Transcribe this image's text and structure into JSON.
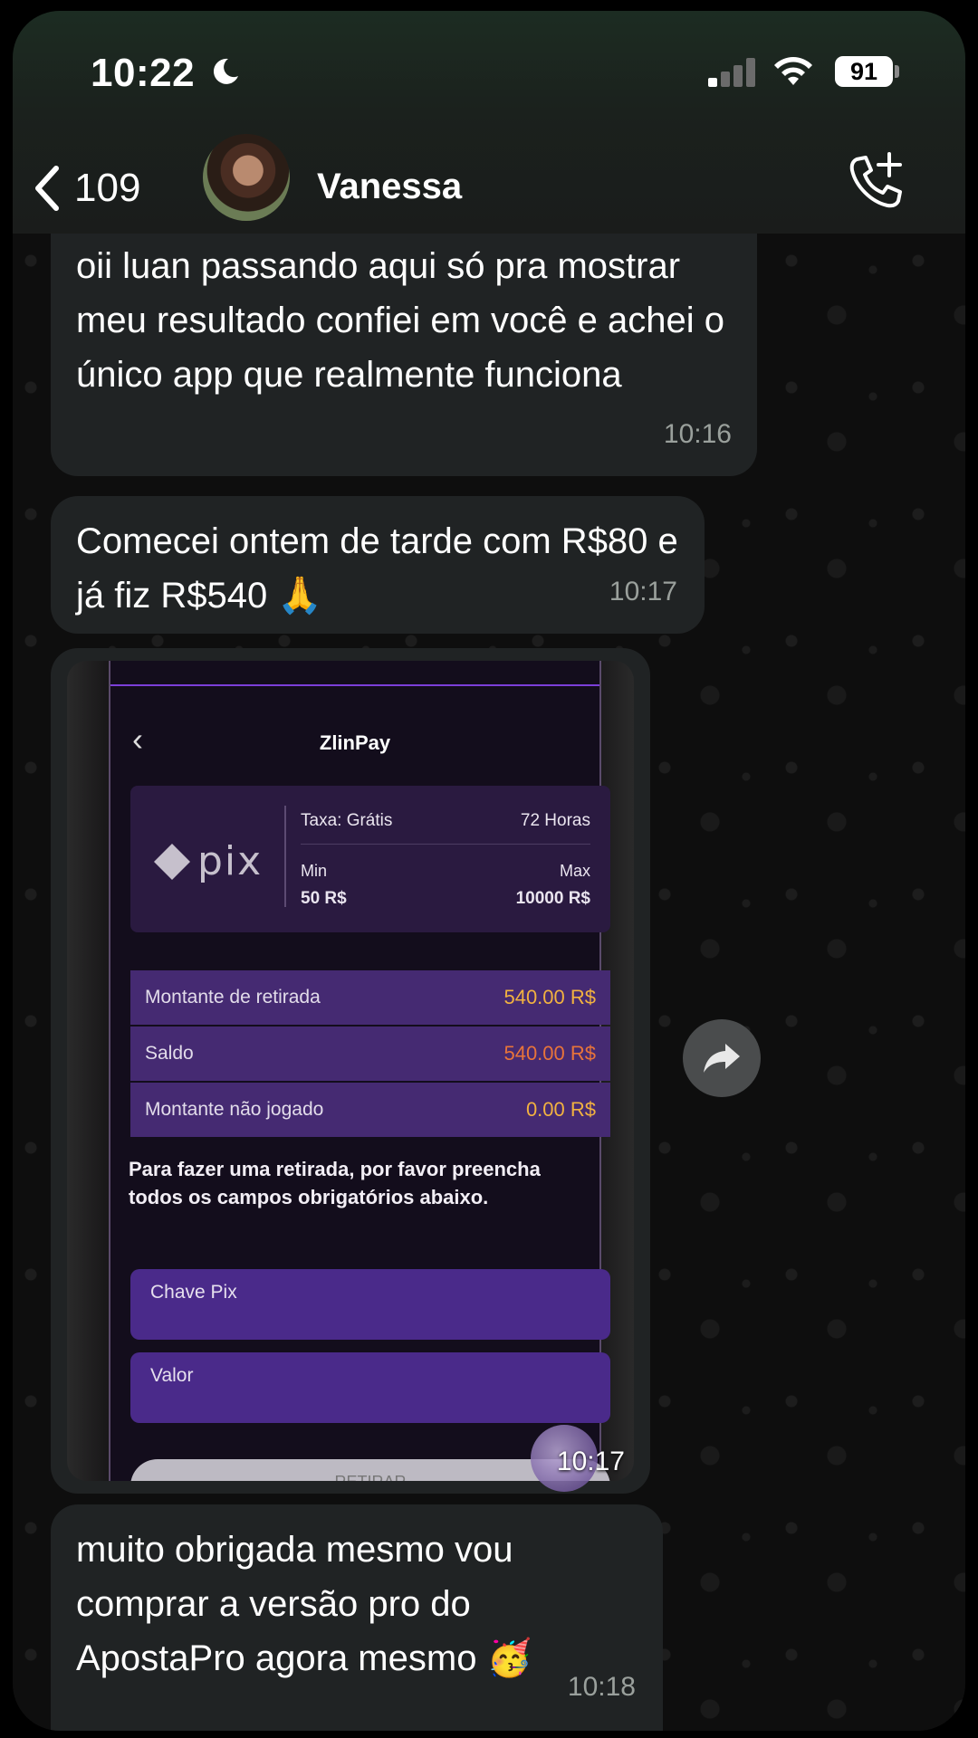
{
  "status_bar": {
    "time": "10:22",
    "battery": "91"
  },
  "header": {
    "back_count": "109",
    "contact_name": "Vanessa"
  },
  "messages": [
    {
      "text": "oii luan passando aqui só pra mostrar meu resultado confiei em você e achei o único app que realmente funciona",
      "time": "10:16"
    },
    {
      "text": "Comecei ontem de tarde com R$80 e já fiz R$540 🙏",
      "time": "10:17"
    },
    {
      "type": "image",
      "time": "10:17"
    },
    {
      "text": "muito obrigada mesmo vou comprar a versão pro do ApostaPro agora mesmo 🥳",
      "time": "10:18"
    }
  ],
  "screenshot": {
    "title": "ZlinPay",
    "pix_logo_text": "pix",
    "fee_label": "Taxa: Grátis",
    "duration": "72 Horas",
    "min_label": "Min",
    "min_value": "50 R$",
    "max_label": "Max",
    "max_value": "10000 R$",
    "rows": [
      {
        "label": "Montante de retirada",
        "value": "540.00 R$",
        "color": "#f2b240"
      },
      {
        "label": "Saldo",
        "value": "540.00 R$",
        "color": "#e8743a"
      },
      {
        "label": "Montante não jogado",
        "value": "0.00 R$",
        "color": "#f2b240"
      }
    ],
    "instructions": "Para fazer uma retirada, por favor preencha todos os campos obrigatórios abaixo.",
    "field_pix_key": "Chave Pix",
    "field_value": "Valor",
    "button": "RETIRAR"
  }
}
